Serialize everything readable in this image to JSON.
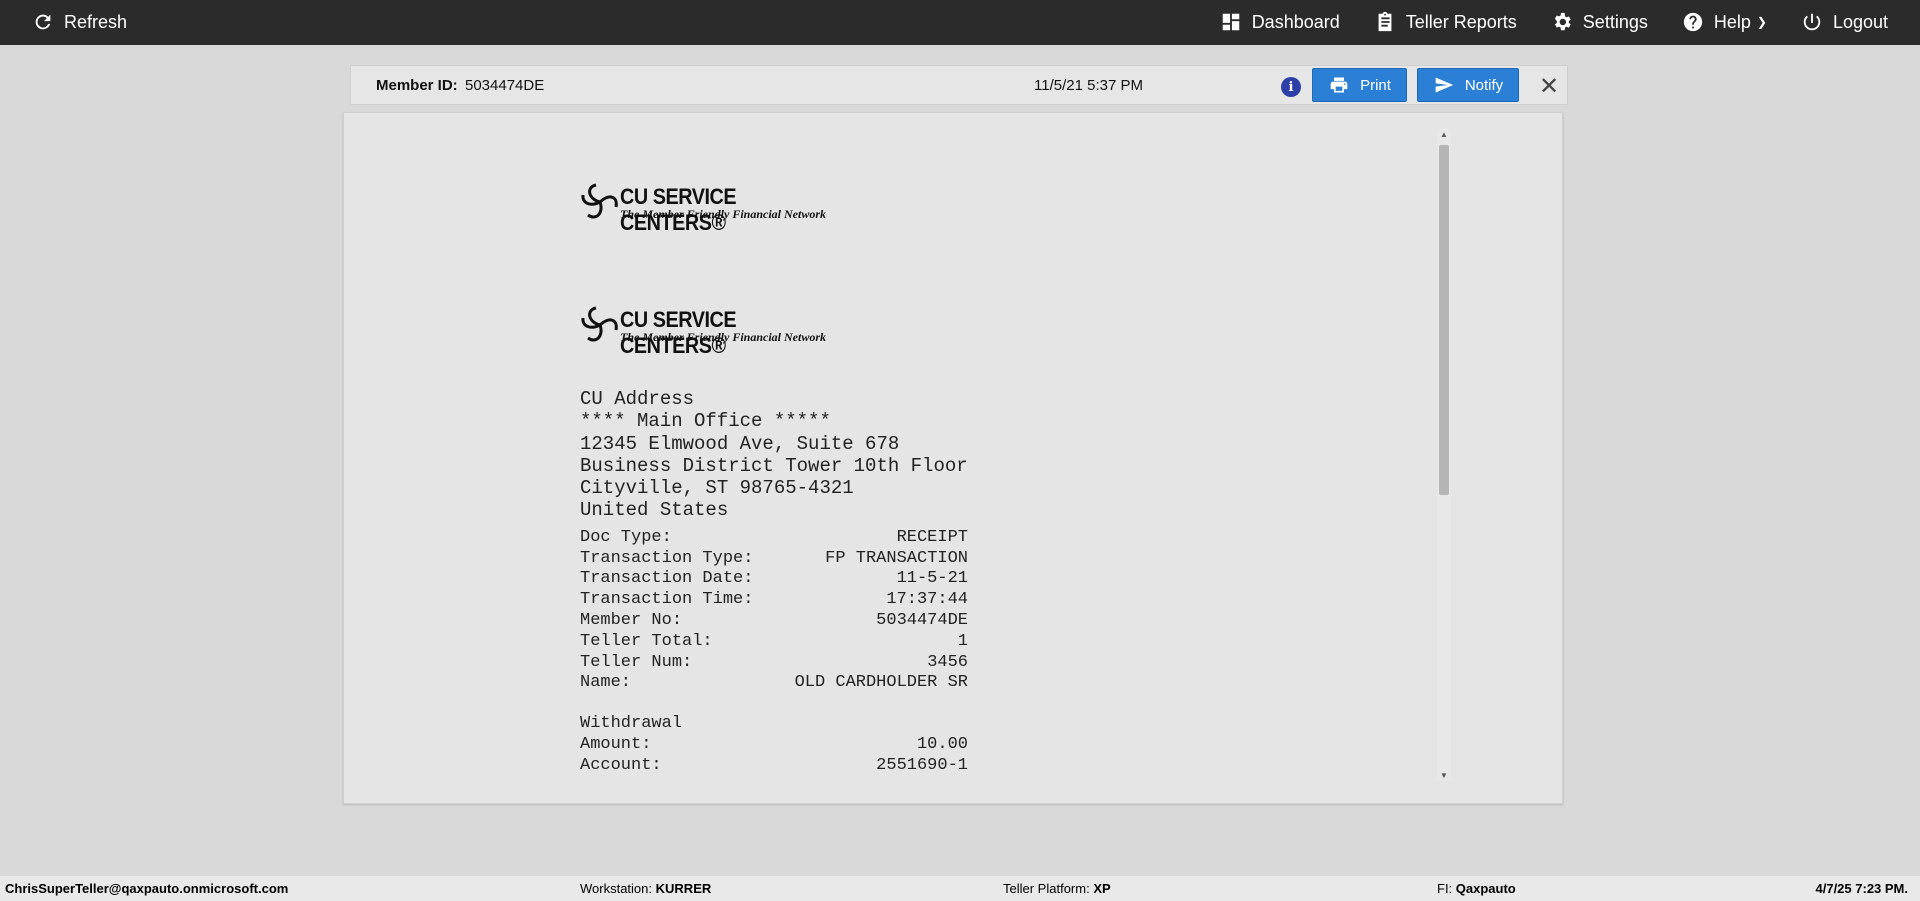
{
  "topbar": {
    "refresh_label": "Refresh",
    "dashboard_label": "Dashboard",
    "teller_reports_label": "Teller Reports",
    "settings_label": "Settings",
    "help_label": "Help",
    "logout_label": "Logout"
  },
  "member_bar": {
    "member_id_label": "Member ID:",
    "member_id": "5034474DE",
    "datetime": "11/5/21 5:37 PM",
    "print_label": "Print",
    "notify_label": "Notify"
  },
  "logo": {
    "title": "CU SERVICE CENTERS®",
    "tagline": "The Member Friendly Financial Network"
  },
  "receipt": {
    "address": [
      "CU Address",
      "**** Main Office *****",
      "12345 Elmwood Ave, Suite 678",
      "Business District Tower 10th Floor",
      "Cityville, ST 98765-4321",
      "United States"
    ],
    "fields": [
      {
        "label": "Doc Type:",
        "value": "RECEIPT"
      },
      {
        "label": "Transaction Type:",
        "value": "FP TRANSACTION"
      },
      {
        "label": "Transaction Date:",
        "value": "11-5-21"
      },
      {
        "label": "Transaction Time:",
        "value": "17:37:44"
      },
      {
        "label": "Member No:",
        "value": "5034474DE"
      },
      {
        "label": "Teller Total:",
        "value": "1"
      },
      {
        "label": "Teller Num:",
        "value": "3456"
      },
      {
        "label": "Name:",
        "value": "OLD CARDHOLDER SR"
      }
    ],
    "withdrawal_title": "Withdrawal",
    "withdrawal": [
      {
        "label": "Amount:",
        "value": "10.00"
      },
      {
        "label": "Account:",
        "value": "2551690-1"
      }
    ]
  },
  "footer": {
    "user": "ChrisSuperTeller@qaxpauto.onmicrosoft.com",
    "workstation_label": "Workstation:",
    "workstation": "KURRER",
    "platform_label": "Teller Platform:",
    "platform": "XP",
    "fi_label": "FI:",
    "fi": "Qaxpauto",
    "timestamp": "4/7/25 7:23 PM."
  },
  "colors": {
    "topbar": "#2b2b2b",
    "button": "#2b7fd4",
    "info": "#2c3fa8"
  }
}
